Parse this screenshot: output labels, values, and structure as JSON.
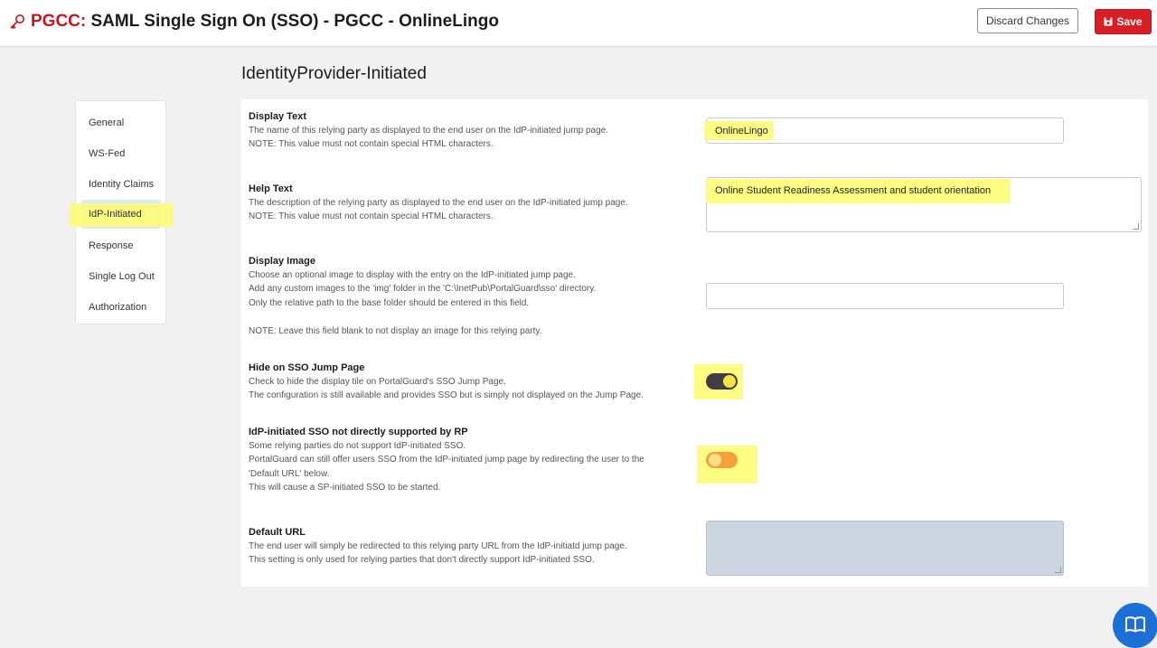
{
  "header": {
    "title_prefix": "PGCC:",
    "title_main": " SAML Single Sign On (SSO) - PGCC - OnlineLingo",
    "discard_label": "Discard Changes",
    "save_label": "Save",
    "key_icon": "key-icon",
    "save_icon": "save-icon"
  },
  "section_title": "IdentityProvider-Initiated",
  "sidebar": {
    "items": [
      {
        "label": "General"
      },
      {
        "label": "WS-Fed"
      },
      {
        "label": "Identity Claims"
      },
      {
        "label": "IdP-Initiated",
        "active": true
      },
      {
        "label": "Response"
      },
      {
        "label": "Single Log Out"
      },
      {
        "label": "Authorization"
      }
    ]
  },
  "fields": {
    "display_text": {
      "label": "Display Text",
      "desc1": "The name of this relying party as displayed to the end user on the IdP-initiated jump page.",
      "desc2": "NOTE: This value must not contain special HTML characters.",
      "value": "OnlineLingo"
    },
    "help_text": {
      "label": "Help Text",
      "desc1": "The description of the relying party as displayed to the end user on the IdP-initiated jump page.",
      "desc2": "NOTE: This value must not contain special HTML characters.",
      "value": "Online Student Readiness Assessment and student orientation"
    },
    "display_image": {
      "label": "Display Image",
      "desc1": "Choose an optional image to display with the entry on the IdP-initiated jump page.",
      "desc2": "Add any custom images to the 'img' folder in the 'C:\\InetPub\\PortalGuard\\sso' directory.",
      "desc3": "Only the relative path to the base folder should be entered in this field.",
      "desc4": "NOTE: Leave this field blank to not display an image for this relying party.",
      "value": ""
    },
    "hide_on_jump": {
      "label": "Hide on SSO Jump Page",
      "desc1": "Check to hide the display tile on PortalGuard's SSO Jump Page.",
      "desc2": "The configuration is still available and provides SSO but is simply not displayed on the Jump Page.",
      "checked": true
    },
    "idp_not_supported": {
      "label": "IdP-initiated SSO not directly supported by RP",
      "desc1": "Some relying parties do not support IdP-initiated SSO.",
      "desc2": "PortalGuard can still offer users SSO from the IdP-initiated jump page by redirecting the user to the",
      "desc3": "'Default URL' below.",
      "desc4": "This will cause a SP-initiated SSO to be started.",
      "checked": false
    },
    "default_url": {
      "label": "Default URL",
      "desc1": "The end user will simply be redirected to this relying party URL from the IdP-initiatd jump page.",
      "desc2": "This setting is only used for relying parties that don't directly support IdP-initiated SSO.",
      "value": "",
      "disabled": true
    }
  },
  "help_button": {
    "icon": "book-icon"
  },
  "colors": {
    "brand_red": "#c4161c",
    "save_button": "#d71f26",
    "highlight": "#fdfd6f",
    "toggle_on_track": "#3f3d45",
    "toggle_on_knob": "#f6e34a",
    "toggle_off_track": "#f5a03b",
    "toggle_off_knob": "#fbe08a",
    "disabled_field": "#cdd6e0",
    "help_fab": "#1b6fd6"
  }
}
